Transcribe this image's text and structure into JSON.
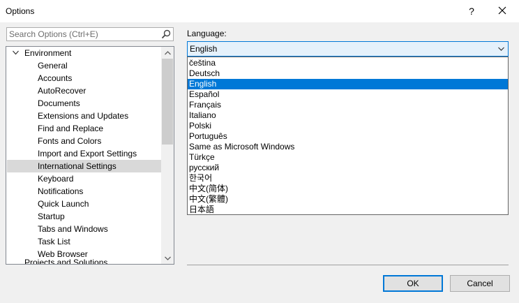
{
  "window": {
    "title": "Options",
    "help_label": "?"
  },
  "search": {
    "placeholder": "Search Options (Ctrl+E)"
  },
  "tree": {
    "root": {
      "label": "Environment"
    },
    "items": [
      {
        "label": "General"
      },
      {
        "label": "Accounts"
      },
      {
        "label": "AutoRecover"
      },
      {
        "label": "Documents"
      },
      {
        "label": "Extensions and Updates"
      },
      {
        "label": "Find and Replace"
      },
      {
        "label": "Fonts and Colors"
      },
      {
        "label": "Import and Export Settings"
      },
      {
        "label": "International Settings",
        "selected": true
      },
      {
        "label": "Keyboard"
      },
      {
        "label": "Notifications"
      },
      {
        "label": "Quick Launch"
      },
      {
        "label": "Startup"
      },
      {
        "label": "Tabs and Windows"
      },
      {
        "label": "Task List"
      },
      {
        "label": "Web Browser"
      }
    ],
    "next_root_partial": "Projects and Solutions"
  },
  "language": {
    "label": "Language:",
    "selected": "English",
    "options": [
      "čeština",
      "Deutsch",
      "English",
      "Español",
      "Français",
      "Italiano",
      "Polski",
      "Português",
      "Same as Microsoft Windows",
      "Türkçe",
      "русский",
      "한국어",
      "中文(简体)",
      "中文(繁體)",
      "日本語"
    ],
    "selected_index": 2
  },
  "buttons": {
    "ok": "OK",
    "cancel": "Cancel"
  },
  "colors": {
    "accent": "#0078d7",
    "selection_gray": "#d9d9d9"
  }
}
